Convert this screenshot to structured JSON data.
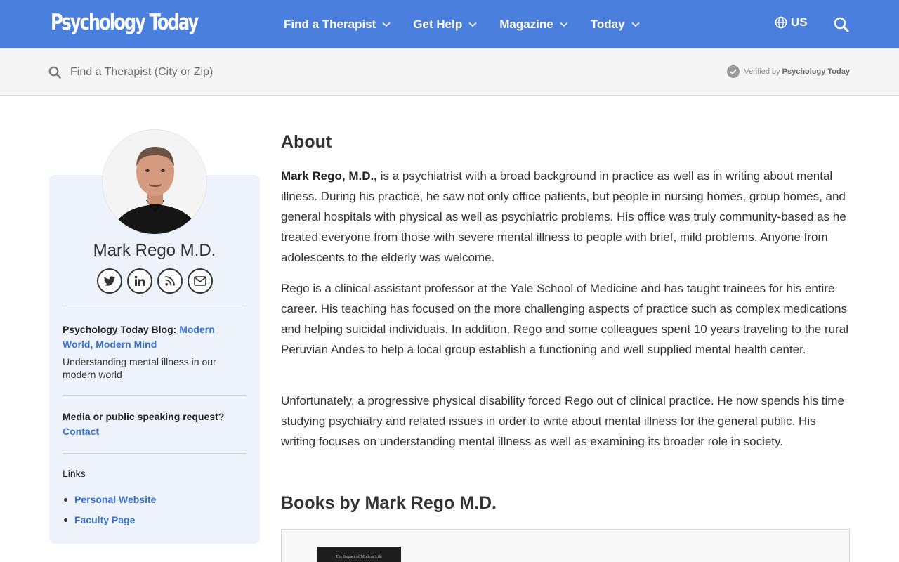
{
  "header": {
    "logo": "Psychology Today",
    "nav": [
      {
        "label": "Find a Therapist"
      },
      {
        "label": "Get Help"
      },
      {
        "label": "Magazine"
      },
      {
        "label": "Today"
      }
    ],
    "region": "US"
  },
  "search": {
    "placeholder": "Find a Therapist (City or Zip)",
    "verified_prefix": "Verified by",
    "verified_brand": "Psychology Today"
  },
  "profile": {
    "name": "Mark Rego M.D.",
    "socials": [
      "twitter-icon",
      "linkedin-icon",
      "rss-icon",
      "mail-icon"
    ],
    "blog_prefix": "Psychology Today Blog:",
    "blog_name": "Modern World, Modern Mind",
    "blog_desc": "Understanding mental illness in our modern world",
    "media_question": "Media or public speaking request?",
    "media_link": "Contact",
    "links_heading": "Links",
    "links": [
      "Personal Website",
      "Faculty Page"
    ]
  },
  "about": {
    "heading": "About",
    "p1_lead": "Mark Rego, M.D.,",
    "p1_rest": " is a psychiatrist with a broad background in practice as well as in writing about mental illness. During his practice, he saw not only office patients, but people in nursing homes, group homes, and general hospitals with physical as well as psychiatric problems. His office was truly community-based as he treated everyone from those with severe mental illness to people with brief, mild problems. Anyone from adolescents to the elderly was welcome.",
    "p2": "Rego is a clinical assistant professor at the Yale School of Medicine and has taught trainees for his entire career. His teaching has focused on the more challenging aspects of practice such as complex medications and helping suicidal individuals. In addition, Rego and some colleagues spent 10 years traveling to the rural Peruvian Andes to help a local group establish a functioning and well supplied mental health center.",
    "p3": "Unfortunately, a progressive physical disability forced Rego out of clinical practice. He now spends his time studying psychiatry and related issues in order to write about mental illness for the general public. His writing focuses on understanding mental illness as well as examining its broader role in society."
  },
  "books": {
    "heading": "Books by Mark Rego M.D.",
    "cover_text": "The Impact of Modern Life"
  }
}
